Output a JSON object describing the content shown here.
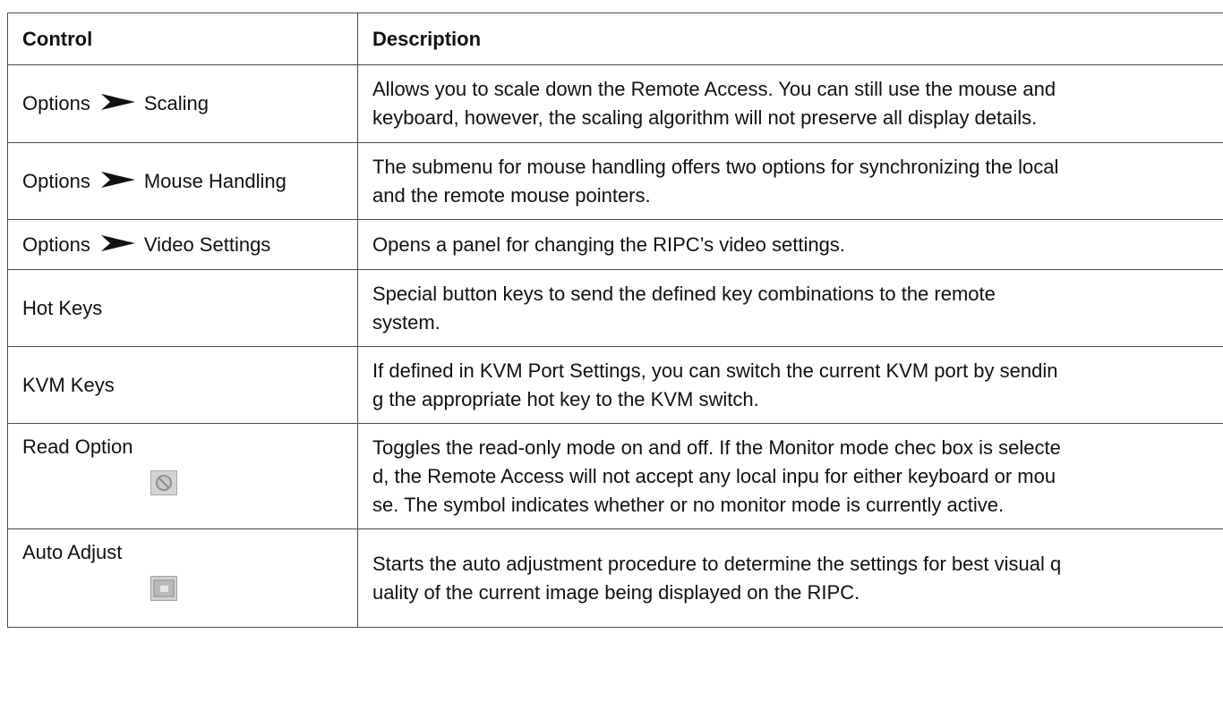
{
  "headers": {
    "control": "Control",
    "description": "Description"
  },
  "rows": [
    {
      "menu": "Options",
      "item": "Scaling",
      "desc": [
        "Allows you to scale down the Remote Access. You can still use the mouse and",
        "keyboard, however, the scaling algorithm will not preserve all display details."
      ]
    },
    {
      "menu": "Options",
      "item": "Mouse Handling",
      "desc": [
        "The submenu for mouse handling offers two options for synchronizing the local",
        "and the remote mouse pointers."
      ]
    },
    {
      "menu": "Options",
      "item": "Video Settings",
      "desc": [
        "Opens a panel for changing the RIPC’s video settings."
      ]
    },
    {
      "control": "Hot Keys",
      "desc": [
        "Special button keys to send the defined key combinations to the remote",
        "system."
      ]
    },
    {
      "control": "KVM Keys",
      "desc": [
        "If defined in KVM Port Settings, you can switch the current KVM port by sendin",
        "g the appropriate hot key to the KVM switch."
      ]
    },
    {
      "control": "Read Option",
      "icon": "monitor-mode-icon",
      "desc": [
        "Toggles the read-only mode on and off. If the Monitor mode chec box is selecte",
        "d, the Remote Access will not accept any local inpu for either keyboard or mou",
        "se. The symbol indicates whether or no monitor mode is currently active."
      ]
    },
    {
      "control": "Auto Adjust",
      "icon": "auto-adjust-icon",
      "desc": [
        "Starts the auto adjustment procedure to determine the settings for best visual q",
        "uality of the current image being displayed on the RIPC."
      ]
    }
  ]
}
